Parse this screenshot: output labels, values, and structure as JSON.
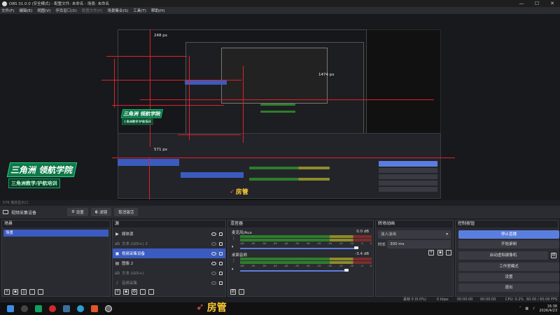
{
  "window": {
    "title": "OBS 31.0.0 (安全模式) - 配置文件: 未命名 - 场景: 未命名",
    "controls": [
      "—",
      "☐",
      "✕"
    ]
  },
  "menu": [
    "文件(F)",
    "编辑(E)",
    "视图(V)",
    "停靠窗口(D)",
    "配置文件(P)",
    "场景集合(S)",
    "工具(T)",
    "帮助(H)"
  ],
  "preview": {
    "px_labels": [
      "248 px",
      "1474 px",
      "571 px"
    ],
    "logo": {
      "line1": "三角洲 领航学院",
      "line2": "三角洲教学/护航培训"
    },
    "room_tag": "房管",
    "room_icon": "rocket-icon"
  },
  "status_line": "576   播放显示口",
  "source_bar": {
    "selected_source": "视频采集设备",
    "buttons": [
      "设置",
      "滤镜",
      "取消激活"
    ]
  },
  "scenes": {
    "header": "场景",
    "items": [
      "场景"
    ]
  },
  "sources": {
    "header": "源",
    "items": [
      {
        "icon": "play-icon",
        "label": "媒体源",
        "selected": false,
        "dim": false
      },
      {
        "icon": "text-icon",
        "label": "文本 (GDI+) 2",
        "selected": false,
        "dim": true
      },
      {
        "icon": "camera-icon",
        "label": "视频采集设备",
        "selected": true,
        "dim": false
      },
      {
        "icon": "image-icon",
        "label": "图像 2",
        "selected": false,
        "dim": false
      },
      {
        "icon": "text-icon",
        "label": "文本 (GDI+)",
        "selected": false,
        "dim": true
      },
      {
        "icon": "speaker-icon",
        "label": "音频采集",
        "selected": false,
        "dim": true
      }
    ]
  },
  "mixer": {
    "header": "混音器",
    "channels": [
      {
        "name": "麦克风/Aux",
        "db": "0.0 dB",
        "level": 0.72
      },
      {
        "name": "桌面音频",
        "db": "-3.4 dB",
        "level": 0.8
      }
    ],
    "scale": [
      "-60",
      "-55",
      "-50",
      "-45",
      "-40",
      "-35",
      "-30",
      "-25",
      "-20",
      "-15",
      "-10",
      "-5",
      "0"
    ]
  },
  "transitions": {
    "header": "转场动画",
    "selected": "淡入淡出",
    "duration_label": "时长",
    "duration_value": "300 ms"
  },
  "controls": {
    "header": "控制按钮",
    "buttons": [
      "停止直播",
      "开始录制",
      "启动虚拟摄像机",
      "工作室模式",
      "设置",
      "退出"
    ]
  },
  "statusbar": {
    "frames": "丢帧 0 (0.0%)",
    "kbps": "0 kbps",
    "live_time": "00:00:00",
    "rec_time": "00:00:00",
    "cpu": "CPU: 0.2%",
    "fps": "60.00 / 60.00 FPS"
  },
  "taskbar": {
    "time": "16:38",
    "date": "2026/4/23"
  },
  "colors": {
    "accent": "#3b5bc0",
    "primary_button": "#5a7ee0",
    "guide_red": "#e0202a",
    "brand_green": "#0d7a48"
  }
}
